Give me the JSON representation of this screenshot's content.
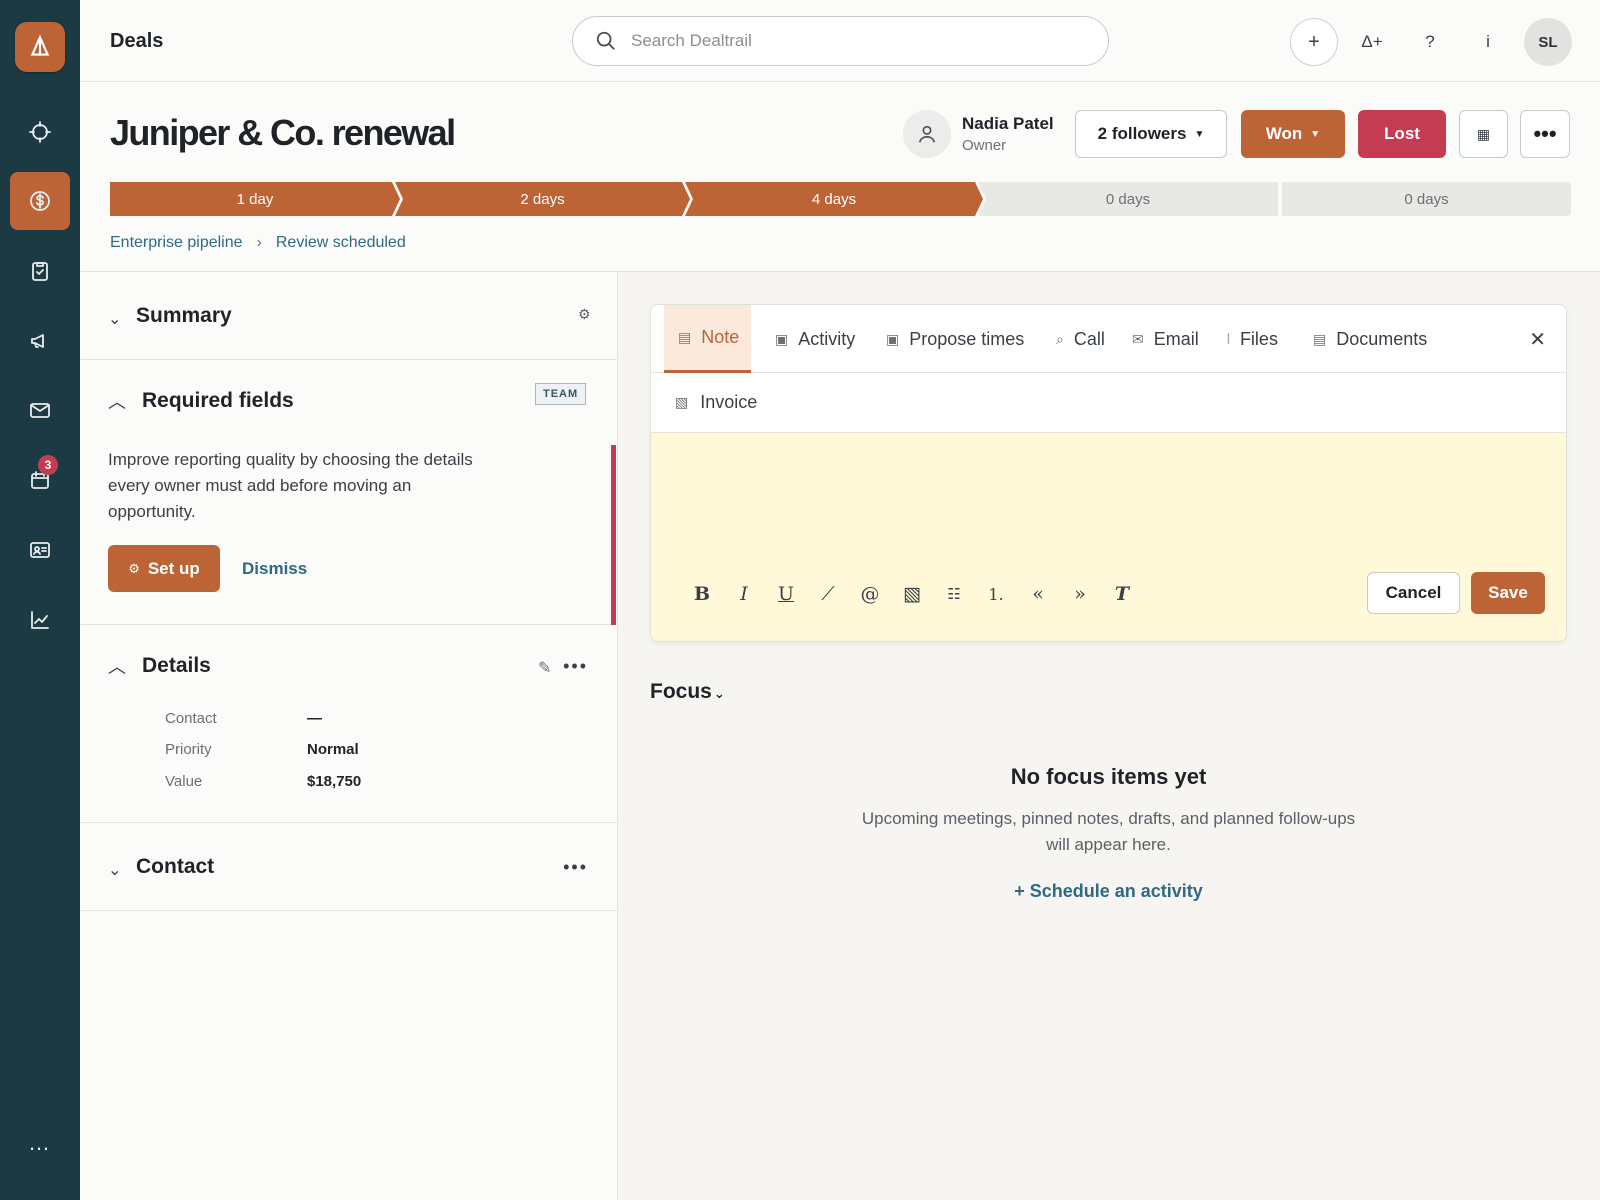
{
  "app": {
    "section_title": "Deals"
  },
  "search": {
    "placeholder": "Search Dealtrail"
  },
  "topbar": {
    "add": "+",
    "user_add": "Δ+",
    "help": "?",
    "info": "i",
    "avatar_initials": "SL"
  },
  "sidebar": {
    "badge_count": "3",
    "more": "…"
  },
  "deal": {
    "title": "Juniper & Co. renewal",
    "owner_name": "Nadia Patel",
    "owner_role": "Owner",
    "followers_label": "2 followers",
    "won_label": "Won",
    "lost_label": "Lost",
    "more_label": "•••",
    "stages": [
      {
        "label": "1 day",
        "done": true
      },
      {
        "label": "2 days",
        "done": true
      },
      {
        "label": "4 days",
        "done": true
      },
      {
        "label": "0 days",
        "done": false
      },
      {
        "label": "0 days",
        "done": false
      }
    ],
    "breadcrumb": [
      "Enterprise pipeline",
      "Review scheduled"
    ]
  },
  "summary": {
    "title": "Summary"
  },
  "required": {
    "title": "Required fields",
    "tag": "TEAM",
    "text": "Improve reporting quality by choosing the details every owner must add before moving an opportunity.",
    "setup_label": "Set up",
    "dismiss_label": "Dismiss"
  },
  "details": {
    "title": "Details",
    "rows": [
      {
        "label": "Contact",
        "value": "—"
      },
      {
        "label": "Priority",
        "value": "Normal"
      },
      {
        "label": "Value",
        "value": "$18,750"
      }
    ]
  },
  "contact": {
    "title": "Contact"
  },
  "composer": {
    "tabs": [
      "Note",
      "Activity",
      "Propose times",
      "Call",
      "Email",
      "Files",
      "Documents"
    ],
    "extra": "Invoice",
    "cancel_label": "Cancel",
    "save_label": "Save"
  },
  "focus": {
    "title": "Focus",
    "empty_title": "No focus items yet",
    "empty_text": "Upcoming meetings, pinned notes, drafts, and planned follow-ups will appear here.",
    "schedule_label": "+ Schedule an activity"
  },
  "colors": {
    "accent": "#bd6436",
    "danger": "#c43c52",
    "sidebar": "#1b3a44",
    "link": "#2f6a84",
    "note_bg": "#fff8d9"
  }
}
